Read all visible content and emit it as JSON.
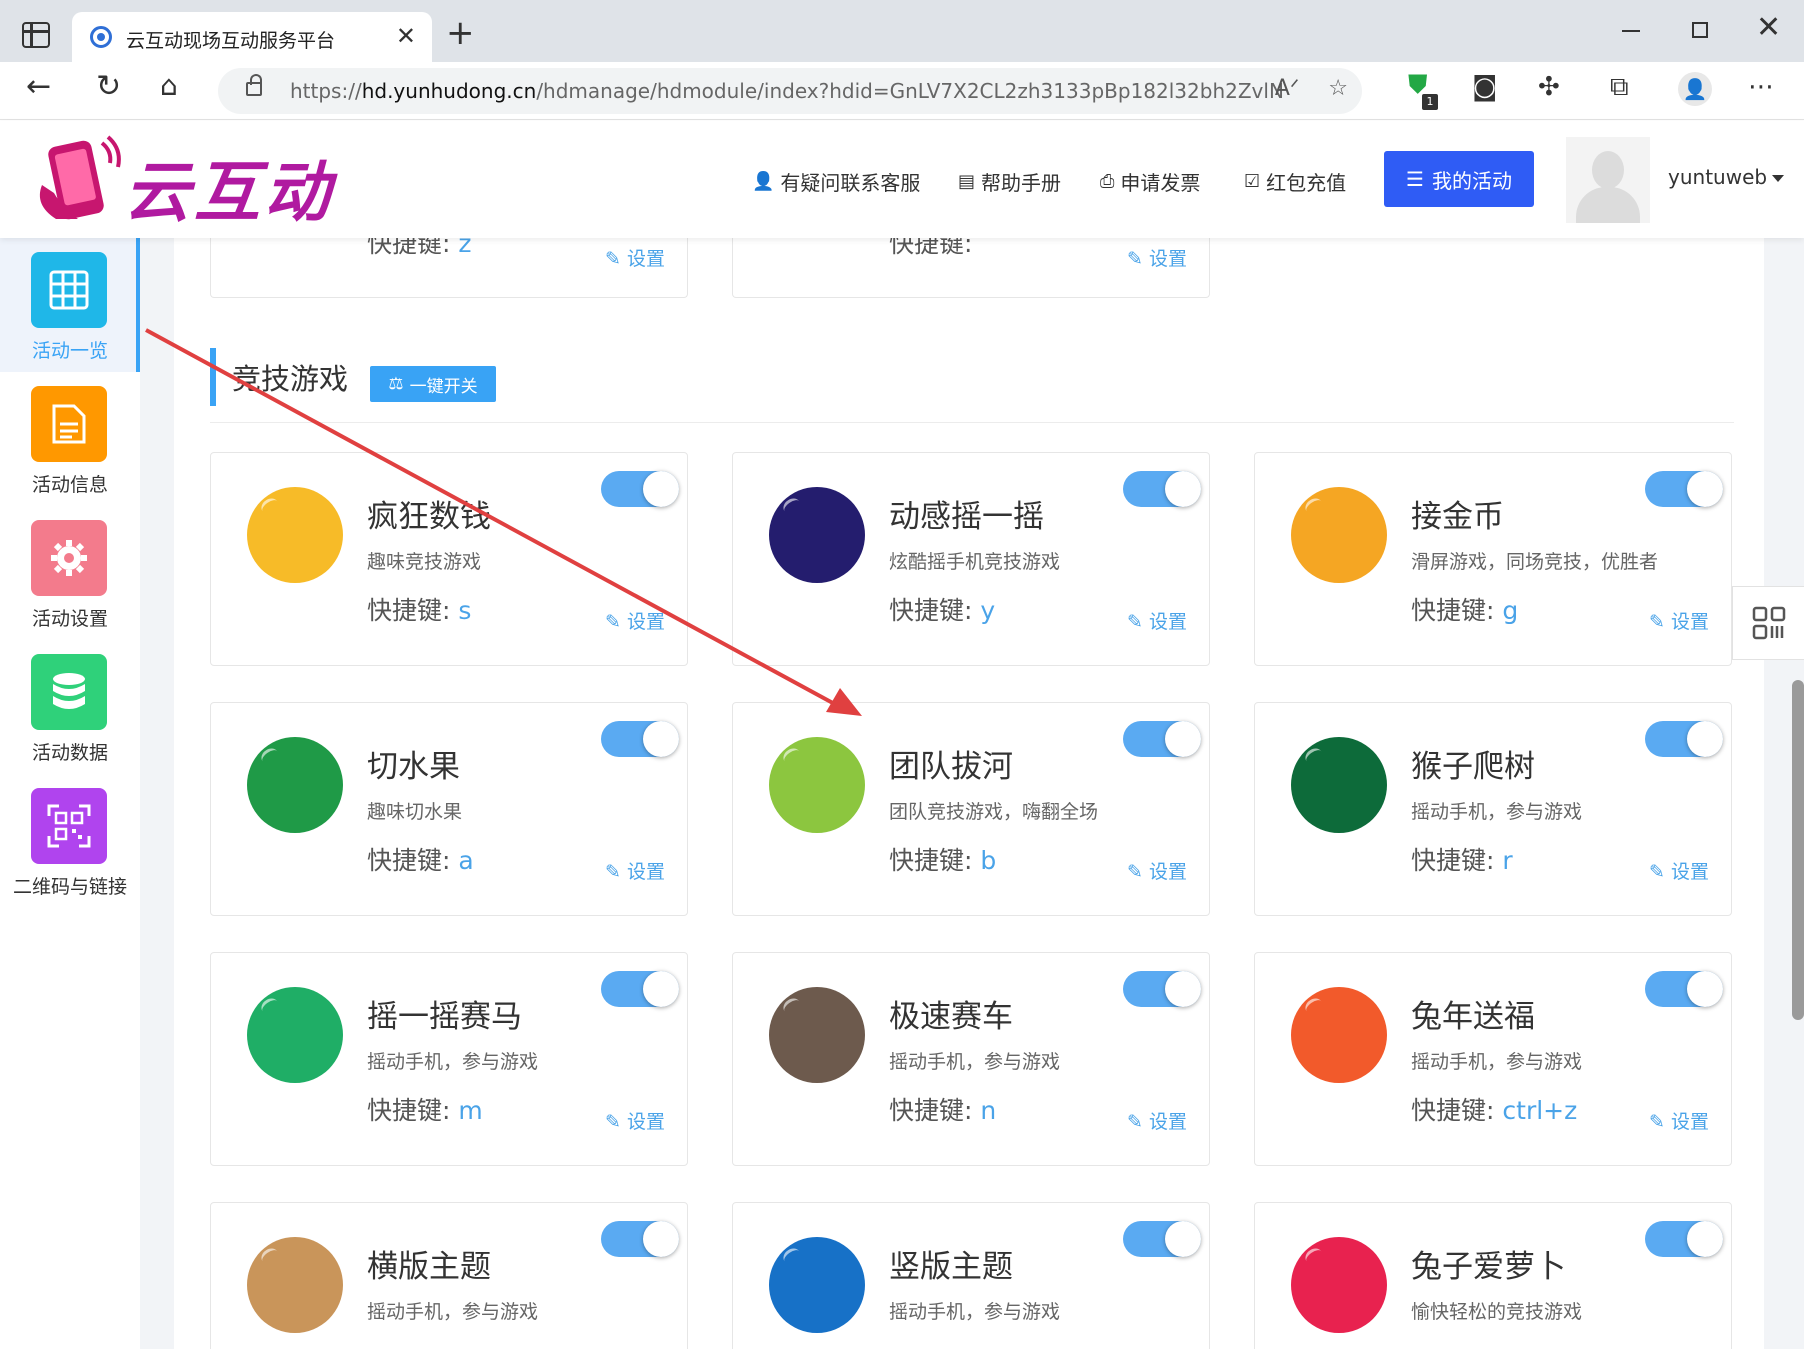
{
  "browser": {
    "tab_title": "云互动现场互动服务平台",
    "url_prefix": "https://",
    "url_host": "hd.yunhudong.cn",
    "url_path": "/hdmanage/hdmodule/index?hdid=GnLV7X2CL2zh3133pBp182l32bh2ZvlN",
    "ext_badge": "1"
  },
  "header": {
    "logo_text": "云互动",
    "nav": [
      {
        "label": "有疑问联系客服",
        "icon": "user-plus-icon"
      },
      {
        "label": "帮助手册",
        "icon": "book-icon"
      },
      {
        "label": "申请发票",
        "icon": "printer-icon"
      },
      {
        "label": "红包充值",
        "icon": "check-shield-icon"
      }
    ],
    "my_activity": "我的活动",
    "username": "yuntuweb"
  },
  "sidebar": {
    "items": [
      {
        "label": "活动一览",
        "color": "#1fb7e8",
        "icon": "grid-icon",
        "active": true
      },
      {
        "label": "活动信息",
        "color": "#ff9800",
        "icon": "document-icon",
        "active": false
      },
      {
        "label": "活动设置",
        "color": "#f37b8c",
        "icon": "gear-icon",
        "active": false
      },
      {
        "label": "活动数据",
        "color": "#2fd17a",
        "icon": "database-icon",
        "active": false
      },
      {
        "label": "二维码与链接",
        "color": "#b044ee",
        "icon": "qrcode-icon",
        "active": false
      }
    ]
  },
  "top_partial": [
    {
      "key_label": "快捷键:",
      "key": "z",
      "set": "设置"
    },
    {
      "key_label": "快捷键:",
      "key": "",
      "set": "设置"
    }
  ],
  "section": {
    "title": "竞技游戏",
    "onekey": "一键开关"
  },
  "games": [
    {
      "name": "疯狂数钱",
      "desc": "趣味竞技游戏",
      "key_label": "快捷键:",
      "key": "s",
      "set": "设置",
      "color": "#f7bb28",
      "icon": "money-cards-icon",
      "on": true
    },
    {
      "name": "动感摇一摇",
      "desc": "炫酷摇手机竞技游戏",
      "key_label": "快捷键:",
      "key": "y",
      "set": "设置",
      "color": "#241d6e",
      "icon": "phone-shake-icon",
      "on": true
    },
    {
      "name": "接金币",
      "desc": "滑屏游戏，同场竞技，优胜者",
      "key_label": "快捷键:",
      "key": "g",
      "set": "设置",
      "color": "#f5a623",
      "icon": "gold-coins-icon",
      "on": true
    },
    {
      "name": "切水果",
      "desc": "趣味切水果",
      "key_label": "快捷键:",
      "key": "a",
      "set": "设置",
      "color": "#1f9a47",
      "icon": "fruit-icon",
      "on": true
    },
    {
      "name": "团队拔河",
      "desc": "团队竞技游戏，嗨翻全场",
      "key_label": "快捷键:",
      "key": "b",
      "set": "设置",
      "color": "#8cc63f",
      "icon": "tug-of-war-icon",
      "on": true
    },
    {
      "name": "猴子爬树",
      "desc": "摇动手机，参与游戏",
      "key_label": "快捷键:",
      "key": "r",
      "set": "设置",
      "color": "#0d6b3a",
      "icon": "palm-tree-icon",
      "on": true
    },
    {
      "name": "摇一摇赛马",
      "desc": "摇动手机，参与游戏",
      "key_label": "快捷键:",
      "key": "m",
      "set": "设置",
      "color": "#1fae66",
      "icon": "horse-racing-icon",
      "on": true
    },
    {
      "name": "极速赛车",
      "desc": "摇动手机，参与游戏",
      "key_label": "快捷键:",
      "key": "n",
      "set": "设置",
      "color": "#6d5a4d",
      "icon": "car-icon",
      "on": true
    },
    {
      "name": "兔年送福",
      "desc": "摇动手机，参与游戏",
      "key_label": "快捷键:",
      "key": "ctrl+z",
      "set": "设置",
      "color": "#f25a2b",
      "icon": "bicycle-icon",
      "on": true
    },
    {
      "name": "横版主题",
      "desc": "摇动手机，参与游戏",
      "color": "#c9955a",
      "icon": "runner-icon",
      "on": true
    },
    {
      "name": "竖版主题",
      "desc": "摇动手机，参与游戏",
      "color": "#1771c7",
      "icon": "swimmer-icon",
      "on": true
    },
    {
      "name": "兔子爱萝卜",
      "desc": "愉快轻松的竞技游戏",
      "color": "#e8224f",
      "icon": "gavel-icon",
      "on": true
    }
  ]
}
